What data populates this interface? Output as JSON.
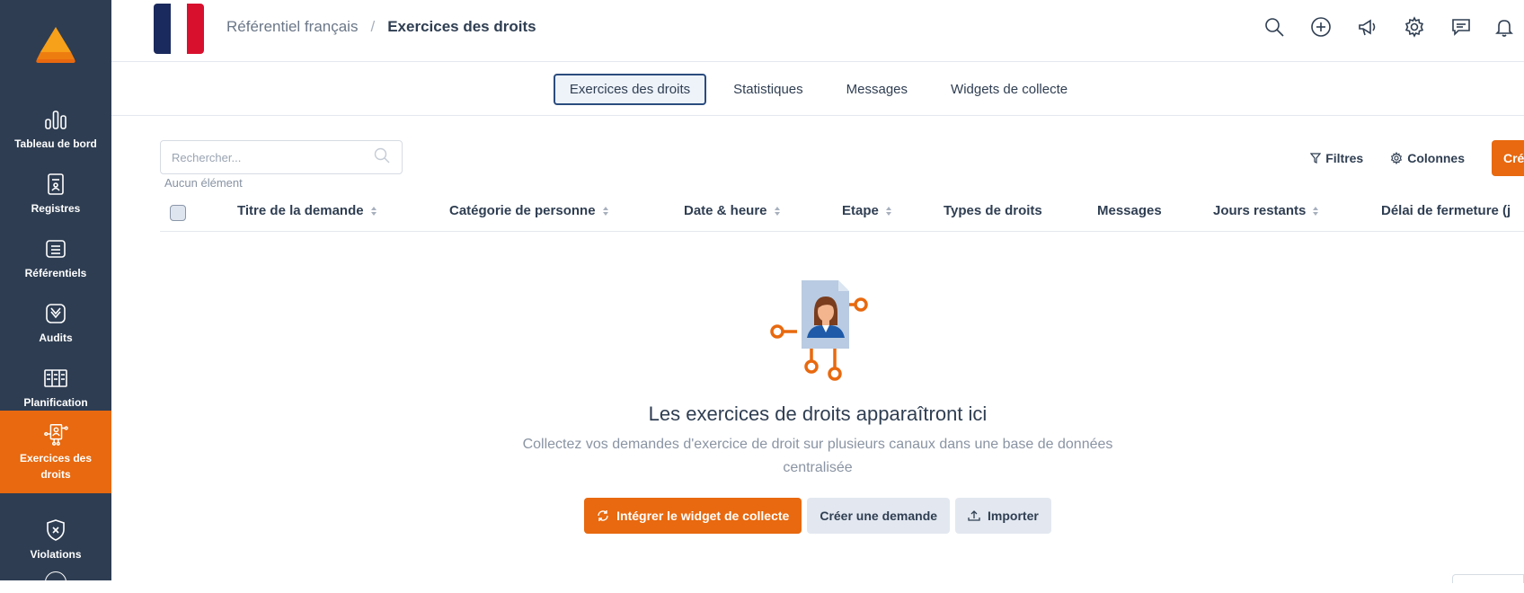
{
  "sidebar": {
    "items": [
      {
        "label": "Tableau de bord",
        "icon": "bar-chart-icon"
      },
      {
        "label": "Registres",
        "icon": "registry-icon"
      },
      {
        "label": "Référentiels",
        "icon": "stack-icon"
      },
      {
        "label": "Audits",
        "icon": "audit-icon"
      },
      {
        "label": "Planification",
        "icon": "planning-icon"
      },
      {
        "label": "Exercices des droits",
        "icon": "rights-request-icon",
        "active": true
      },
      {
        "label": "Violations",
        "icon": "violation-shield-icon"
      }
    ]
  },
  "header": {
    "breadcrumb": {
      "parent": "Référentiel français",
      "separator": "/",
      "current": "Exercices des droits"
    },
    "flag_colors": [
      "#1b2a5e",
      "#ffffff",
      "#d8102e"
    ],
    "icons": [
      "search-icon",
      "add-icon",
      "megaphone-icon",
      "gear-icon",
      "chat-icon",
      "bell-icon"
    ]
  },
  "tabs": [
    {
      "label": "Exercices des droits",
      "active": true
    },
    {
      "label": "Statistiques"
    },
    {
      "label": "Messages"
    },
    {
      "label": "Widgets de collecte"
    }
  ],
  "toolbar": {
    "search_placeholder": "Rechercher...",
    "count_label": "Aucun élément",
    "filters_label": "Filtres",
    "columns_label": "Colonnes",
    "create_label": "Créer"
  },
  "table": {
    "columns": [
      {
        "label": "Titre de la demande",
        "sortable": true
      },
      {
        "label": "Catégorie de personne",
        "sortable": true
      },
      {
        "label": "Date & heure",
        "sortable": true
      },
      {
        "label": "Etape",
        "sortable": true
      },
      {
        "label": "Types de droits",
        "sortable": false
      },
      {
        "label": "Messages",
        "sortable": false
      },
      {
        "label": "Jours restants",
        "sortable": true
      },
      {
        "label": "Délai de fermeture (j",
        "sortable": false
      }
    ]
  },
  "empty_state": {
    "title": "Les exercices de droits apparaîtront ici",
    "description": "Collectez vos demandes d'exercice de droit sur plusieurs canaux dans une base de données centralisée",
    "primary_button": "Intégrer le widget de collecte",
    "secondary_button": "Créer une demande",
    "import_button": "Importer"
  },
  "colors": {
    "sidebar_bg": "#2e3d52",
    "accent": "#e8690f",
    "text": "#2f3e52",
    "active_tab_border": "#2b4c7e"
  }
}
